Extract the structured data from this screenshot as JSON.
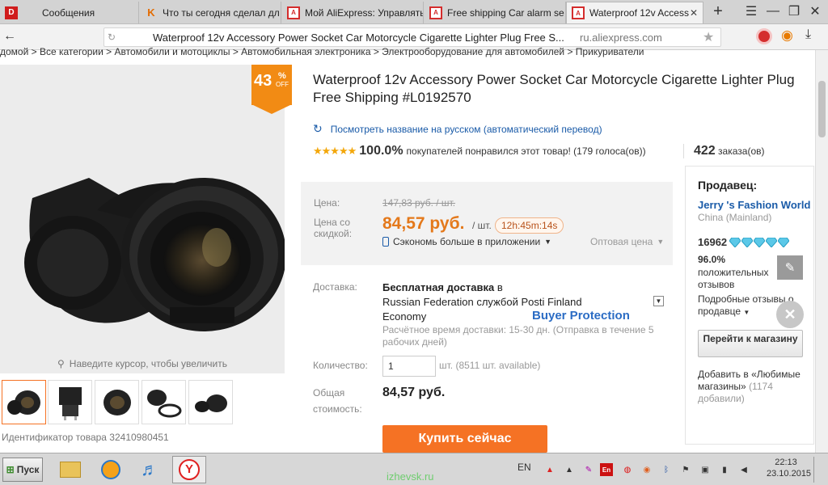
{
  "tabs": [
    {
      "label": "Сообщения",
      "favicon": "D"
    },
    {
      "label": "Что ты сегодня сделал дл",
      "favicon": "K"
    },
    {
      "label": "Мой AliExpress: Управлять",
      "favicon": "A"
    },
    {
      "label": "Free shipping Car alarm se",
      "favicon": "A"
    },
    {
      "label": "Waterproof 12v Access",
      "favicon": "A"
    }
  ],
  "address": {
    "title": "Waterproof 12v Accessory Power Socket Car Motorcycle Cigarette Lighter Plug Free S...",
    "domain": "ru.aliexpress.com"
  },
  "breadcrumb": "домой > Все категории > Автомобили и мотоциклы > Автомобильная электроника > Электрооборудование для автомобилей > Прикуриватели",
  "gallery": {
    "discount_pct": "43",
    "discount_unit": "%",
    "discount_off": "OFF",
    "zoom_hint": "Наведите курсор, чтобы увеличить",
    "product_id": "Идентификатор товара 32410980451"
  },
  "product": {
    "title": "Waterproof 12v Accessory Power Socket Car Motorcycle Cigarette Lighter Plug Free Shipping #L0192570",
    "translate": "Посмотреть название на русском (автоматический перевод)",
    "rating_pct": "100.0%",
    "rating_text": "покупателей понравился этот товар! (179 голоса(ов))",
    "orders_count": "422",
    "orders_label": "заказа(ов)",
    "stars": 5
  },
  "price": {
    "label": "Цена:",
    "old": "147,83 руб. / шт.",
    "disc_label": "Цена со скидкой:",
    "new": "84,57 руб.",
    "unit": "/ шт.",
    "timer": "12h:45m:14s",
    "app": "Сэкономь больше в приложении",
    "wholesale": "Оптовая цена"
  },
  "shipping": {
    "label": "Доставка:",
    "free": "Бесплатная доставка",
    "to": "в",
    "country_service": "Russian Federation службой Posti Finland",
    "service2": "Economy",
    "time": "Расчётное время доставки: 15-30 дн. (Отправка в течение 5 рабочих дней)",
    "protection": "Buyer Protection"
  },
  "quantity": {
    "label": "Количество:",
    "value": "1",
    "available": "шт. (8511 шт. available)"
  },
  "total": {
    "label1": "Общая",
    "label2": "стоимость:",
    "value": "84,57 руб."
  },
  "buy_label": "Купить сейчас",
  "seller": {
    "heading": "Продавец:",
    "name": "Jerry 's Fashion World",
    "location": "China (Mainland)",
    "score": "16962",
    "positive_pct": "96.0%",
    "positive_label": "положительных отзывов",
    "detail_link": "Подробные отзывы о продавце",
    "store_btn": "Перейти к магазину",
    "fav_text": "Добавить в «Любимые магазины»",
    "fav_count": "(1174 добавили)"
  },
  "taskbar": {
    "start": "Пуск",
    "lang": "EN",
    "time": "22:13",
    "date": "23.10.2015",
    "watermark": "izhevsk.ru"
  },
  "colors": {
    "accent": "#f57224",
    "link": "#1a5ba8",
    "badge": "#f28b14",
    "price": "#e4791b",
    "protection": "#2b6cc4"
  }
}
